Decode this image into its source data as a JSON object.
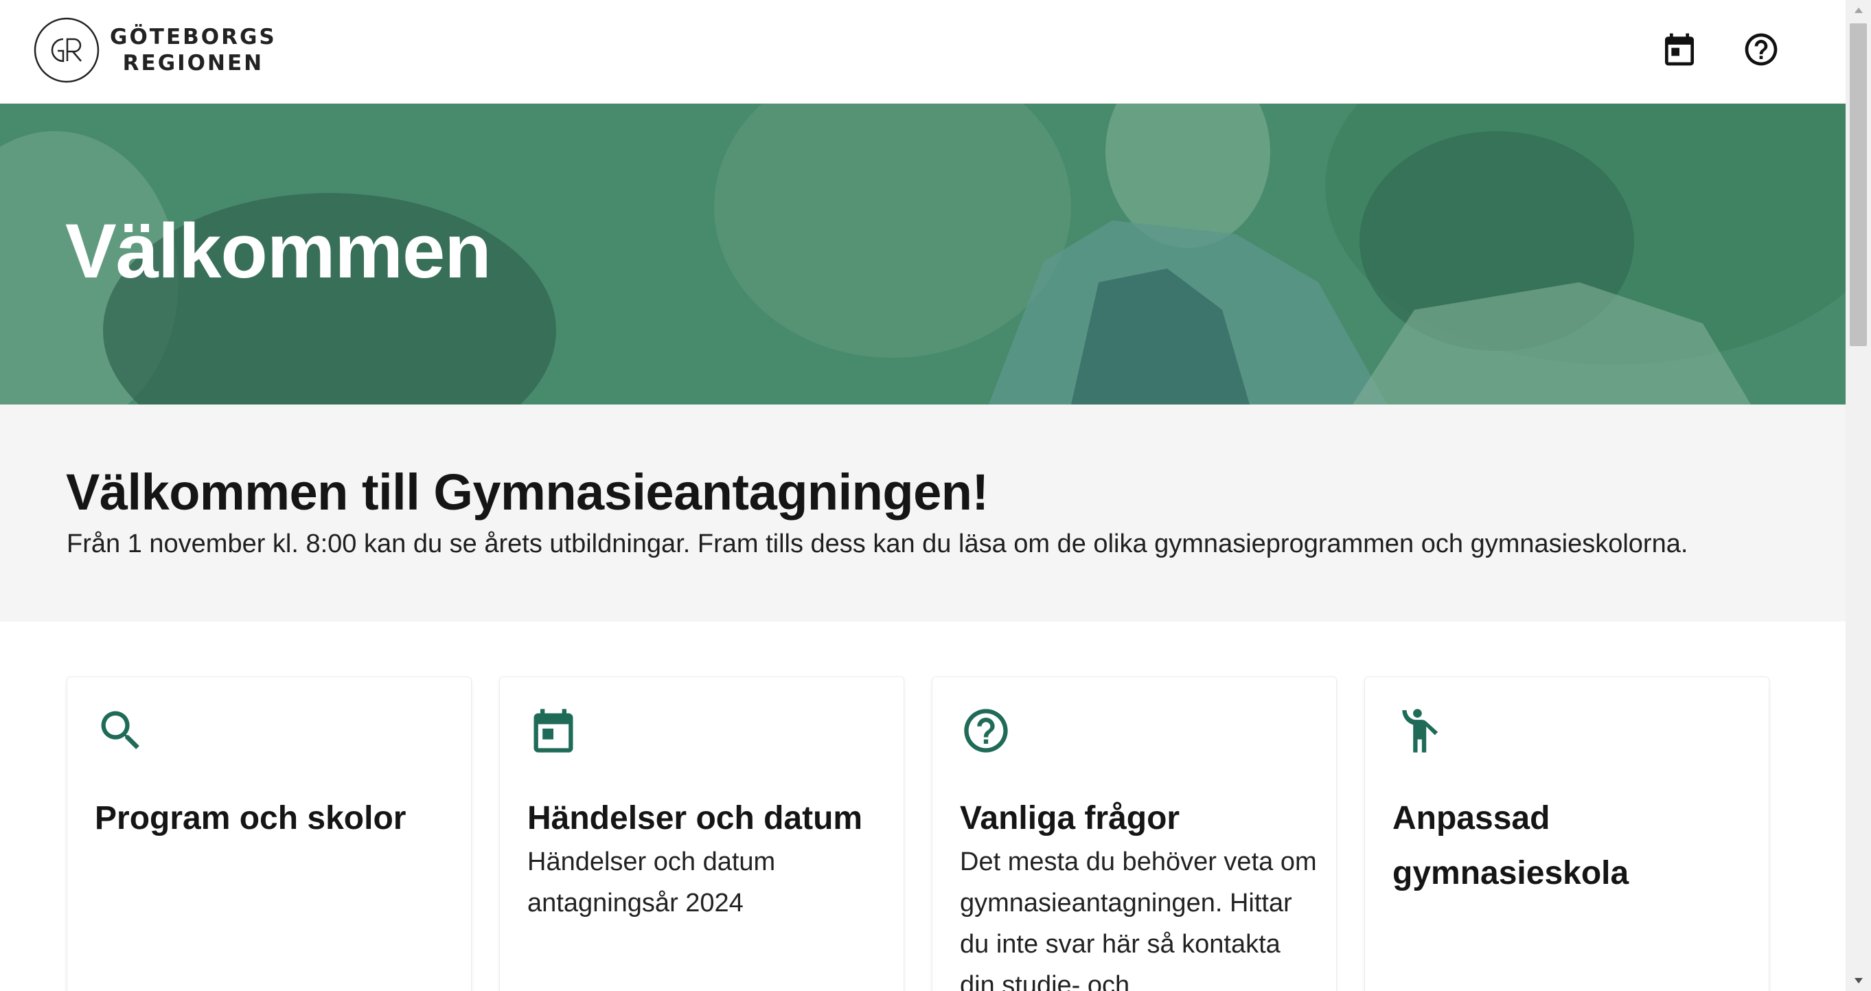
{
  "header": {
    "logo_line1": "GÖTEBORGS",
    "logo_line2": "REGIONEN",
    "calendar_icon": "calendar-icon",
    "help_icon": "help-circle-icon"
  },
  "hero": {
    "title": "Välkommen"
  },
  "intro": {
    "title": "Välkommen till Gymnasieantagningen!",
    "text": "Från 1 november kl. 8:00 kan du se årets utbildningar. Fram tills dess kan du läsa om de olika gymnasieprogrammen och gymnasieskolorna."
  },
  "cards": [
    {
      "icon": "search-icon",
      "title": "Program och skolor",
      "description": ""
    },
    {
      "icon": "calendar-icon",
      "title": "Händelser och datum",
      "description": "Händelser och datum antagningsår 2024"
    },
    {
      "icon": "help-circle-icon",
      "title": "Vanliga frågor",
      "description": "Det mesta du behöver veta om gymnasieantagningen. Hittar du inte svar här så kontakta din studie- och"
    },
    {
      "icon": "accessibility-person-icon",
      "title": "Anpassad gymnasieskola",
      "description": ""
    }
  ],
  "colors": {
    "accent": "#1f6b58",
    "hero_overlay": "#3f8a6a",
    "header_icon": "#111111"
  }
}
